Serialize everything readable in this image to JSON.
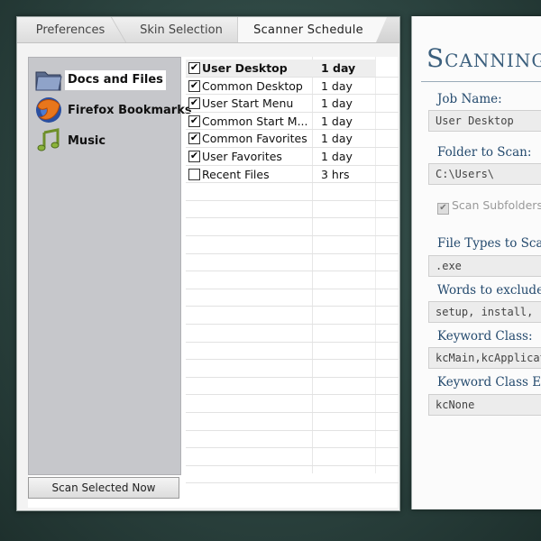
{
  "tabs": [
    {
      "label": "Preferences"
    },
    {
      "label": "Skin Selection"
    },
    {
      "label": "Scanner Schedule"
    }
  ],
  "sources": [
    {
      "label": "Docs and Files",
      "icon": "folder-icon",
      "selected": true
    },
    {
      "label": "Firefox Bookmarks",
      "icon": "firefox-icon",
      "selected": false
    },
    {
      "label": "Music",
      "icon": "music-note-icon",
      "selected": false
    }
  ],
  "scan_button_label": "Scan Selected Now",
  "schedule": [
    {
      "name": "User Desktop",
      "period": "1 day",
      "checked": true
    },
    {
      "name": "Common Desktop",
      "period": "1 day",
      "checked": true
    },
    {
      "name": "User Start Menu",
      "period": "1 day",
      "checked": true
    },
    {
      "name": "Common Start M...",
      "period": "1 day",
      "checked": true
    },
    {
      "name": "Common Favorites",
      "period": "1 day",
      "checked": true
    },
    {
      "name": "User Favorites",
      "period": "1 day",
      "checked": true
    },
    {
      "name": "Recent Files",
      "period": "3 hrs",
      "checked": false
    }
  ],
  "right": {
    "title": "Scanning",
    "job_name_label": "Job Name:",
    "job_name_value": "User Desktop",
    "folder_label": "Folder to Scan:",
    "folder_value": "C:\\Users\\",
    "subfolders_label": "Scan Subfolders",
    "file_types_label": "File Types to Scan",
    "file_types_value": ".exe",
    "exclude_label": "Words to exclude:",
    "exclude_value": "setup, install, rem",
    "keyword_class_label": "Keyword Class:",
    "keyword_class_value": "kcMain,kcApplicat",
    "keyword_class_exp_label": "Keyword Class Exp",
    "keyword_class_exp_value": "kcNone"
  },
  "colors": {
    "accent": "#3b5f7d",
    "background": "#2c4440"
  }
}
